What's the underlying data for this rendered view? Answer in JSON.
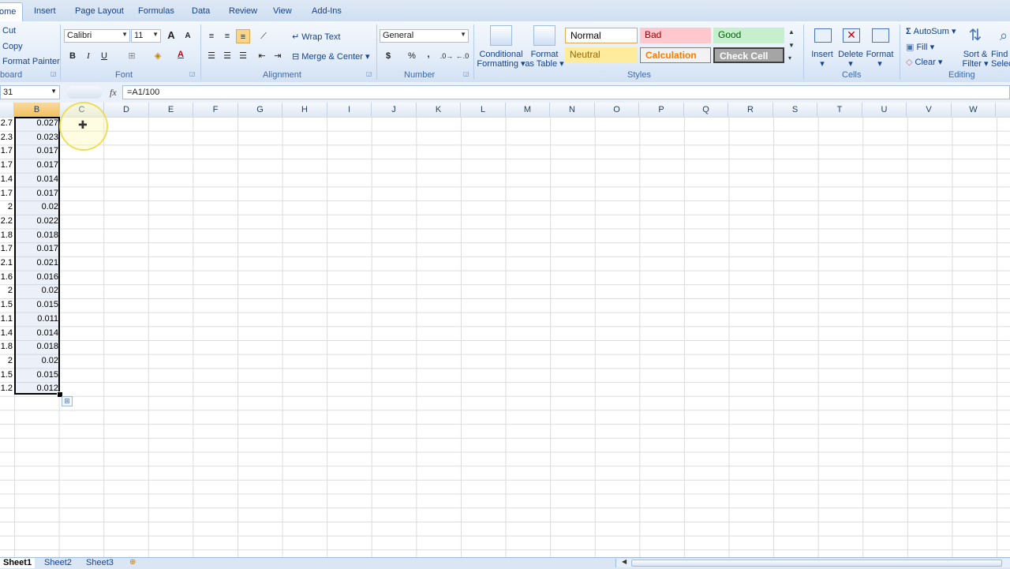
{
  "tabs": [
    "ome",
    "Insert",
    "Page Layout",
    "Formulas",
    "Data",
    "Review",
    "View",
    "Add-Ins"
  ],
  "clipboard": {
    "cut": "Cut",
    "copy": "Copy",
    "format_painter": "Format Painter",
    "label": "board"
  },
  "font": {
    "name": "Calibri",
    "size": "11",
    "bold": "B",
    "italic": "I",
    "underline": "U",
    "grow": "A",
    "shrink": "A",
    "color_letter": "A",
    "label": "Font"
  },
  "alignment": {
    "wrap": "Wrap Text",
    "merge": "Merge & Center",
    "label": "Alignment"
  },
  "number": {
    "format": "General",
    "currency": "$",
    "percent": "%",
    "comma": ",",
    "label": "Number"
  },
  "styles": {
    "conditional": "Conditional",
    "conditional2": "Formatting",
    "format_table": "Format",
    "format_table2": "as Table",
    "normal": "Normal",
    "bad": "Bad",
    "good": "Good",
    "neutral": "Neutral",
    "calculation": "Calculation",
    "check_cell": "Check Cell",
    "label": "Styles"
  },
  "cells": {
    "insert": "Insert",
    "delete": "Delete",
    "format": "Format",
    "label": "Cells"
  },
  "editing": {
    "autosum": "AutoSum",
    "fill": "Fill",
    "clear": "Clear",
    "sort": "Sort &",
    "sort2": "Filter",
    "find": "Find",
    "find2": "Selec",
    "label": "Editing"
  },
  "name_box": "31",
  "fx": "fx",
  "formula": "=A1/100",
  "columns": [
    "B",
    "C",
    "D",
    "E",
    "F",
    "G",
    "H",
    "I",
    "J",
    "K",
    "L",
    "M",
    "N",
    "O",
    "P",
    "Q",
    "R",
    "S",
    "T",
    "U",
    "V",
    "W"
  ],
  "col_a_values": [
    "2.7",
    "2.3",
    "1.7",
    "1.7",
    "1.4",
    "1.7",
    "2",
    "2.2",
    "1.8",
    "1.7",
    "2.1",
    "1.6",
    "2",
    "1.5",
    "1.1",
    "1.4",
    "1.8",
    "2",
    "1.5",
    "1.2"
  ],
  "col_b_values": [
    "0.027",
    "0.023",
    "0.017",
    "0.017",
    "0.014",
    "0.017",
    "0.02",
    "0.022",
    "0.018",
    "0.017",
    "0.021",
    "0.016",
    "0.02",
    "0.015",
    "0.011",
    "0.014",
    "0.018",
    "0.02",
    "0.015",
    "0.012"
  ],
  "sheets": [
    "Sheet1",
    "Sheet2",
    "Sheet3"
  ],
  "colors": {
    "ribbon_text": "#15428b",
    "selected_header": "#f1c15f",
    "bad_bg": "#ffc7ce",
    "good_bg": "#c6efce",
    "neutral_bg": "#ffeb9c",
    "check_bg": "#a5a5a5"
  }
}
